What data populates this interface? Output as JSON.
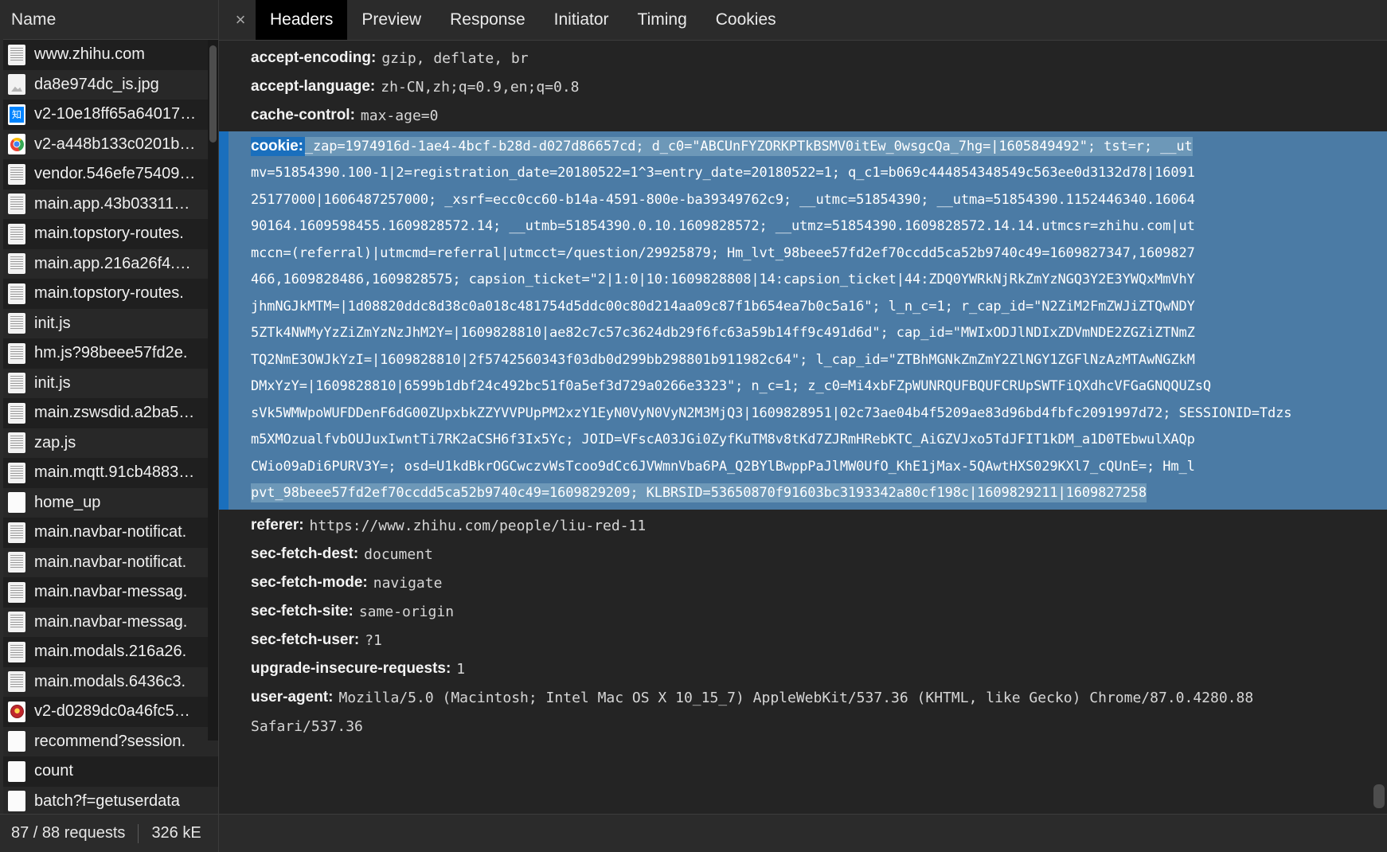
{
  "left_panel": {
    "column_header": "Name",
    "requests": [
      {
        "name": "www.zhihu.com",
        "icon": "document-icon"
      },
      {
        "name": "da8e974dc_is.jpg",
        "icon": "image-icon"
      },
      {
        "name": "v2-10e18ff65a64017…",
        "icon": "zhihu-favicon-icon"
      },
      {
        "name": "v2-a448b133c0201b…",
        "icon": "chrome-favicon-icon"
      },
      {
        "name": "vendor.546efe75409…",
        "icon": "document-icon"
      },
      {
        "name": "main.app.43b03311…",
        "icon": "document-icon"
      },
      {
        "name": "main.topstory-routes.",
        "icon": "document-icon"
      },
      {
        "name": "main.app.216a26f4.…",
        "icon": "document-icon"
      },
      {
        "name": "main.topstory-routes.",
        "icon": "document-icon"
      },
      {
        "name": "init.js",
        "icon": "document-icon"
      },
      {
        "name": "hm.js?98beee57fd2e.",
        "icon": "document-icon"
      },
      {
        "name": "init.js",
        "icon": "document-icon"
      },
      {
        "name": "main.zswsdid.a2ba5…",
        "icon": "document-icon"
      },
      {
        "name": "zap.js",
        "icon": "document-icon"
      },
      {
        "name": "main.mqtt.91cb4883…",
        "icon": "document-icon"
      },
      {
        "name": "home_up",
        "icon": "blank-icon"
      },
      {
        "name": "main.navbar-notificat.",
        "icon": "document-icon"
      },
      {
        "name": "main.navbar-notificat.",
        "icon": "document-icon"
      },
      {
        "name": "main.navbar-messag.",
        "icon": "document-icon"
      },
      {
        "name": "main.navbar-messag.",
        "icon": "document-icon"
      },
      {
        "name": "main.modals.216a26.",
        "icon": "document-icon"
      },
      {
        "name": "main.modals.6436c3.",
        "icon": "document-icon"
      },
      {
        "name": "v2-d0289dc0a46fc5…",
        "icon": "badge-favicon-icon"
      },
      {
        "name": "recommend?session.",
        "icon": "blank-icon"
      },
      {
        "name": "count",
        "icon": "blank-icon"
      },
      {
        "name": "batch?f=getuserdata",
        "icon": "blank-icon"
      }
    ],
    "status_bar": {
      "requests": "87 / 88 requests",
      "transferred": "326 kE"
    }
  },
  "tab_bar": {
    "close_glyph": "×",
    "tabs": [
      {
        "label": "Headers",
        "active": true
      },
      {
        "label": "Preview",
        "active": false
      },
      {
        "label": "Response",
        "active": false
      },
      {
        "label": "Initiator",
        "active": false
      },
      {
        "label": "Timing",
        "active": false
      },
      {
        "label": "Cookies",
        "active": false
      }
    ]
  },
  "headers": {
    "before_cookie": [
      {
        "key": "accept-encoding:",
        "value": "gzip, deflate, br"
      },
      {
        "key": "accept-language:",
        "value": "zh-CN,zh;q=0.9,en;q=0.8"
      },
      {
        "key": "cache-control:",
        "value": "max-age=0"
      }
    ],
    "cookie": {
      "key": "cookie:",
      "lines": [
        "_zap=1974916d-1ae4-4bcf-b28d-d027d86657cd; d_c0=\"ABCUnFYZORKPTkBSMV0itEw_0wsgcQa_7hg=|1605849492\"; tst=r; __ut",
        "mv=51854390.100-1|2=registration_date=20180522=1^3=entry_date=20180522=1; q_c1=b069c444854348549c563ee0d3132d78|16091",
        "25177000|1606487257000; _xsrf=ecc0cc60-b14a-4591-800e-ba39349762c9; __utmc=51854390; __utma=51854390.1152446340.16064",
        "90164.1609598455.1609828572.14; __utmb=51854390.0.10.1609828572; __utmz=51854390.1609828572.14.14.utmcsr=zhihu.com|ut",
        "mccn=(referral)|utmcmd=referral|utmcct=/question/29925879; Hm_lvt_98beee57fd2ef70ccdd5ca52b9740c49=1609827347,1609827",
        "466,1609828486,1609828575; capsion_ticket=\"2|1:0|10:1609828808|14:capsion_ticket|44:ZDQ0YWRkNjRkZmYzNGQ3Y2E3YWQxMmVhY",
        "jhmNGJkMTM=|1d08820ddc8d38c0a018c481754d5ddc00c80d214aa09c87f1b654ea7b0c5a16\"; l_n_c=1; r_cap_id=\"N2ZiM2FmZWJiZTQwNDY",
        "5ZTk4NWMyYzZiZmYzNzJhM2Y=|1609828810|ae82c7c57c3624db29f6fc63a59b14ff9c491d6d\"; cap_id=\"MWIxODJlNDIxZDVmNDE2ZGZiZTNmZ",
        "TQ2NmE3OWJkYzI=|1609828810|2f5742560343f03db0d299bb298801b911982c64\"; l_cap_id=\"ZTBhMGNkZmZmY2ZlNGY1ZGFlNzAzMTAwNGZkM",
        "DMxYzY=|1609828810|6599b1dbf24c492bc51f0a5ef3d729a0266e3323\"; n_c=1; z_c0=Mi4xbFZpWUNRQUFBQUFCRUpSWTFiQXdhcVFGaGNQQUZsQ",
        "sVk5WMWpoWUFDDenF6dG00ZUpxbkZZYVVPUpPM2xzY1EyN0VyN0VyN2M3MjQ3|1609828951|02c73ae04b4f5209ae83d96bd4fbfc2091997d72; SESSIONID=Tdzs",
        "m5XMOzualfvbOUJuxIwntTi7RK2aCSH6f3Ix5Yc; JOID=VFscA03JGi0ZyfKuTM8v8tKd7ZJRmHRebKTC_AiGZVJxo5TdJFIT1kDM_a1D0TEbwulXAQp",
        "CWio09aDi6PURV3Y=; osd=U1kdBkrOGCwczvWsTcoo9dCc6JVWmnVba6PA_Q2BYlBwppPaJlMW0UfO_KhE1jMax-5QAwtHXS029KXl7_cQUnE=; Hm_l"
      ],
      "last_line_text": "pvt_98beee57fd2ef70ccdd5ca52b9740c49=1609829209; KLBRSID=53650870f91603bc3193342a80cf198c|1609829211|1609827258"
    },
    "after_cookie": [
      {
        "key": "referer:",
        "value": "https://www.zhihu.com/people/liu-red-11"
      },
      {
        "key": "sec-fetch-dest:",
        "value": "document"
      },
      {
        "key": "sec-fetch-mode:",
        "value": "navigate"
      },
      {
        "key": "sec-fetch-site:",
        "value": "same-origin"
      },
      {
        "key": "sec-fetch-user:",
        "value": "?1"
      },
      {
        "key": "upgrade-insecure-requests:",
        "value": "1"
      }
    ],
    "user_agent": {
      "key": "user-agent:",
      "line1": "Mozilla/5.0 (Macintosh; Intel Mac OS X 10_15_7) AppleWebKit/537.36 (KHTML, like Gecko) Chrome/87.0.4280.88",
      "line2": "Safari/537.36"
    }
  },
  "colors": {
    "background": "#242424",
    "sidebar": "#1f1f1f",
    "selection_blue": "#4b7ba5",
    "selection_key_blue": "#1a6fbd",
    "active_tab": "#000000"
  }
}
